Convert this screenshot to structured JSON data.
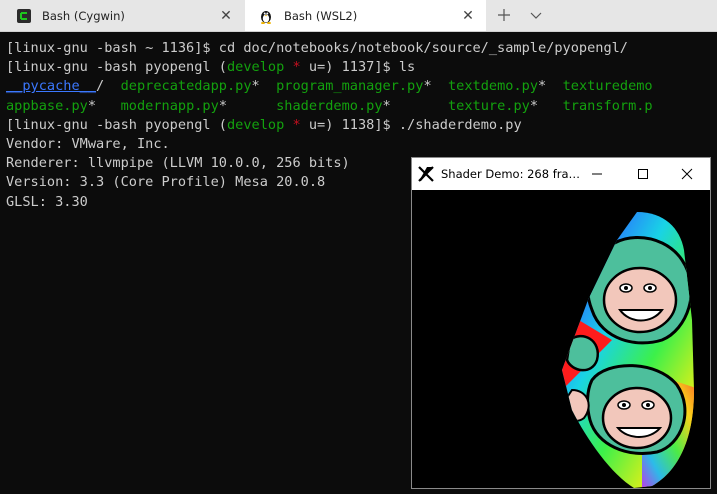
{
  "tabs": [
    {
      "label": "Bash (Cygwin)",
      "icon": "cygwin-icon",
      "active": false
    },
    {
      "label": "Bash (WSL2)",
      "icon": "linux-penguin-icon",
      "active": true
    }
  ],
  "terminal": {
    "l1": "[linux-gnu -bash ~ 1136]$ cd doc/notebooks/notebook/source/_sample/pyopengl/",
    "l2": {
      "a": "[linux-gnu -bash pyopengl (",
      "branch": "develop",
      "star": " *",
      "b": " u=) 1137]$ ls"
    },
    "l3": {
      "c1": "__pycache__",
      "c1s": "/  ",
      "c2": "deprecatedapp.py",
      "c2s": "*  ",
      "c3": "program_manager.py",
      "c3s": "*  ",
      "c4": "textdemo.py",
      "c4s": "*  ",
      "c5": "texturedemo"
    },
    "l4": {
      "c1": "appbase.py",
      "c1s": "*   ",
      "c2": "modernapp.py",
      "c2s": "*      ",
      "c3": "shaderdemo.py",
      "c3s": "*       ",
      "c4": "texture.py",
      "c4s": "*   ",
      "c5": "transform.p"
    },
    "l5": {
      "a": "[linux-gnu -bash pyopengl (",
      "branch": "develop",
      "star": " *",
      "b": " u=) 1138]$ ./shaderdemo.py"
    },
    "l6": "Vendor: VMware, Inc.",
    "l7": "Renderer: llvmpipe (LLVM 10.0.0, 256 bits)",
    "l8": "Version: 3.3 (Core Profile) Mesa 20.0.8",
    "l9": "GLSL: 3.30"
  },
  "shader_window": {
    "title": "Shader Demo: 268 fram…",
    "icon": "x11-icon"
  },
  "colors": {
    "terminal_bg": "#0c0c0c",
    "green": "#13a10e",
    "red": "#c50f1f",
    "blue": "#3b78ff"
  }
}
